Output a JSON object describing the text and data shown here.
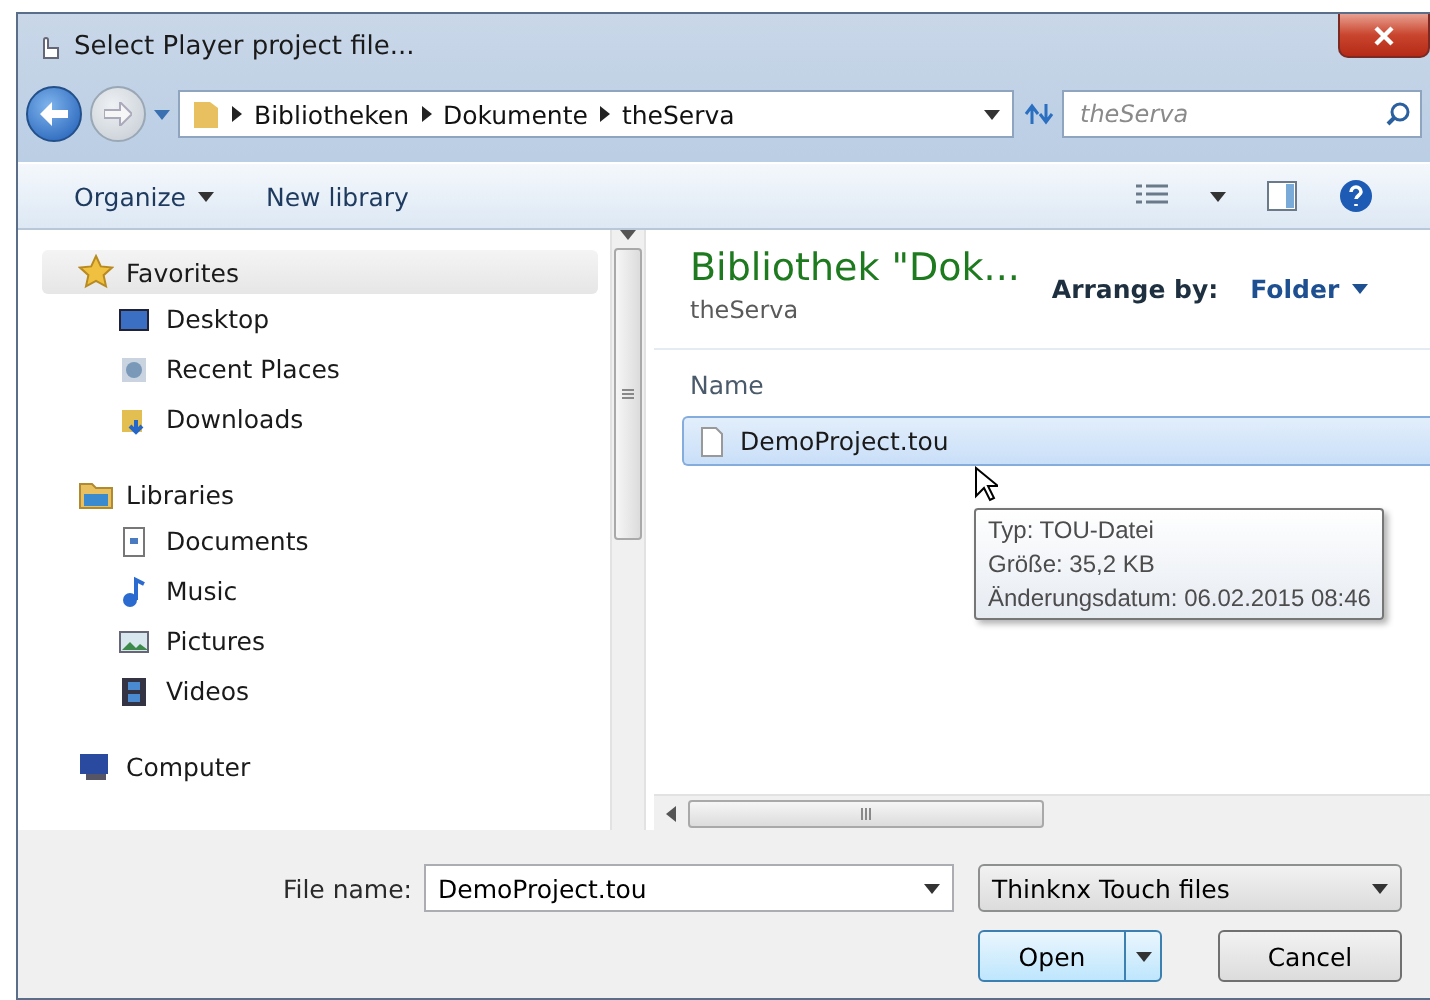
{
  "window": {
    "title": "Select Player project file..."
  },
  "address_bar": {
    "breadcrumb": [
      "Bibliotheken",
      "Dokumente",
      "theServa"
    ],
    "search": {
      "placeholder": "theServa"
    }
  },
  "toolbar": {
    "buttons": [
      "Organize",
      "New library"
    ]
  },
  "sidebar": {
    "groups": [
      {
        "label": "Favorites",
        "highlighted": true,
        "items": [
          "Desktop",
          "Recent Places",
          "Downloads"
        ]
      },
      {
        "label": "Libraries",
        "highlighted": false,
        "items": [
          "Documents",
          "Music",
          "Pictures",
          "Videos"
        ]
      },
      {
        "label": "Computer",
        "highlighted": false
      }
    ]
  },
  "content": {
    "title": "Bibliothek \"Dok...",
    "subtitle": "theServa",
    "arrange_label": "Arrange by:",
    "arrange_value": "Folder",
    "column": "Name",
    "files": [
      {
        "name": "DemoProject.tou",
        "selected": true
      }
    ],
    "tooltip": [
      "Typ: TOU-Datei",
      "Größe: 35,2 KB",
      "Änderungsdatum: 06.02.2015 08:46"
    ]
  },
  "footer": {
    "file_name_label": "File name:",
    "file_name": "DemoProject.tou",
    "filter": "Thinknx Touch files",
    "open": "Open",
    "cancel": "Cancel"
  }
}
